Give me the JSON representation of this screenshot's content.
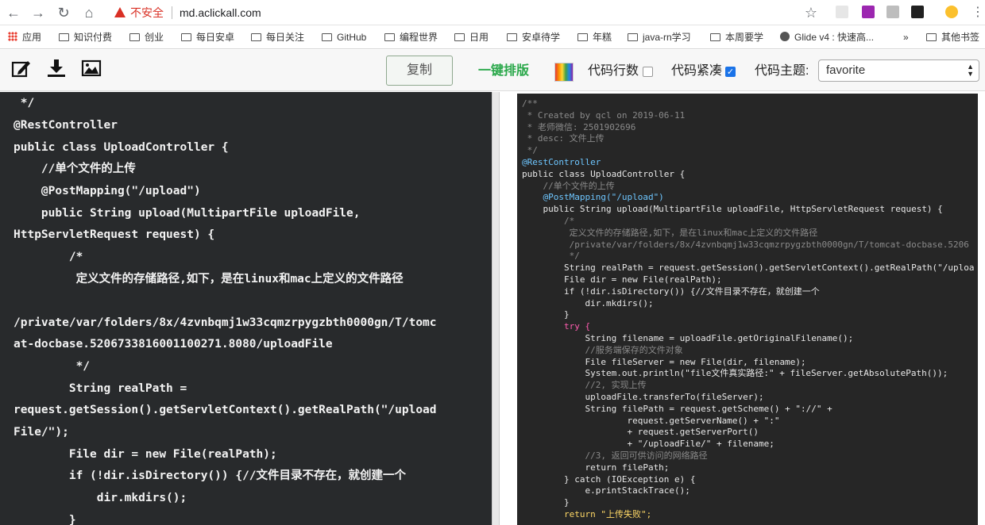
{
  "browser": {
    "insecure_label": "不安全",
    "url": "md.aclickall.com"
  },
  "bookmarks": {
    "items": [
      "应用",
      "知识付费",
      "创业",
      "每日安卓",
      "每日关注",
      "GitHub",
      "编程世界",
      "日用",
      "安卓待学",
      "年糕",
      "java-rn学习",
      "本周要学",
      "Glide v4 : 快速高...",
      "»",
      "其他书签"
    ]
  },
  "toolbar": {
    "copy_label": "复制",
    "format_label": "一键排版",
    "line_numbers_label": "代码行数",
    "line_numbers_checked": false,
    "compact_label": "代码紧凑",
    "compact_checked": true,
    "theme_label": "代码主题:",
    "theme_value": "favorite"
  },
  "editor": {
    "lines": [
      " */",
      "@RestController",
      "public class UploadController {",
      "    //单个文件的上传",
      "    @PostMapping(\"/upload\")",
      "    public String upload(MultipartFile uploadFile,",
      "HttpServletRequest request) {",
      "        /*",
      "         定义文件的存储路径,如下，是在linux和mac上定义的文件路径",
      "",
      "/private/var/folders/8x/4zvnbqmj1w33cqmzrpygzbth0000gn/T/tomc",
      "at-docbase.5206733816001100271.8080/uploadFile",
      "         */",
      "        String realPath =",
      "request.getSession().getServletContext().getRealPath(\"/upload",
      "File/\");",
      "        File dir = new File(realPath);",
      "        if (!dir.isDirectory()) {//文件目录不存在，就创建一个",
      "            dir.mkdirs();",
      "        }"
    ]
  },
  "preview": {
    "lines": [
      "/**",
      " * Created by qcl on 2019-06-11",
      " * 老师微信: 2501902696",
      " * desc: 文件上传",
      " */",
      "@RestController",
      "public class UploadController {",
      "    //单个文件的上传",
      "    @PostMapping(\"/upload\")",
      "    public String upload(MultipartFile uploadFile, HttpServletRequest request) {",
      "        /*",
      "         定义文件的存储路径,如下，是在linux和mac上定义的文件路径",
      "         /private/var/folders/8x/4zvnbqmj1w33cqmzrpygzbth0000gn/T/tomcat-docbase.5206",
      "         */",
      "        String realPath = request.getSession().getServletContext().getRealPath(\"/uploa",
      "        File dir = new File(realPath);",
      "        if (!dir.isDirectory()) {//文件目录不存在，就创建一个",
      "            dir.mkdirs();",
      "        }",
      "        try {",
      "            String filename = uploadFile.getOriginalFilename();",
      "            //服务端保存的文件对象",
      "            File fileServer = new File(dir, filename);",
      "            System.out.println(\"file文件真实路径:\" + fileServer.getAbsolutePath());",
      "            //2, 实现上传",
      "            uploadFile.transferTo(fileServer);",
      "            String filePath = request.getScheme() + \"://\" +",
      "                    request.getServerName() + \":\"",
      "                    + request.getServerPort()",
      "                    + \"/uploadFile/\" + filename;",
      "            //3, 返回可供访问的网络路径",
      "            return filePath;",
      "        } catch (IOException e) {",
      "            e.printStackTrace();",
      "        }",
      "        return \"上传失败\";"
    ]
  },
  "colors": {
    "insecure": "#d93025",
    "format_button": "#2aa84a",
    "editor_bg": "#282a2c",
    "preview_bg": "#262626",
    "keyword": "#ff5cb0",
    "annotation": "#6ec6ff",
    "string": "#ffd866",
    "comment": "#8a8a8a"
  },
  "icons": {
    "toolbar": [
      "edit-icon",
      "download-icon",
      "image-icon"
    ],
    "browser_nav": [
      "back-icon",
      "forward-icon",
      "reload-icon",
      "home-icon",
      "star-icon",
      "menu-icon"
    ]
  }
}
